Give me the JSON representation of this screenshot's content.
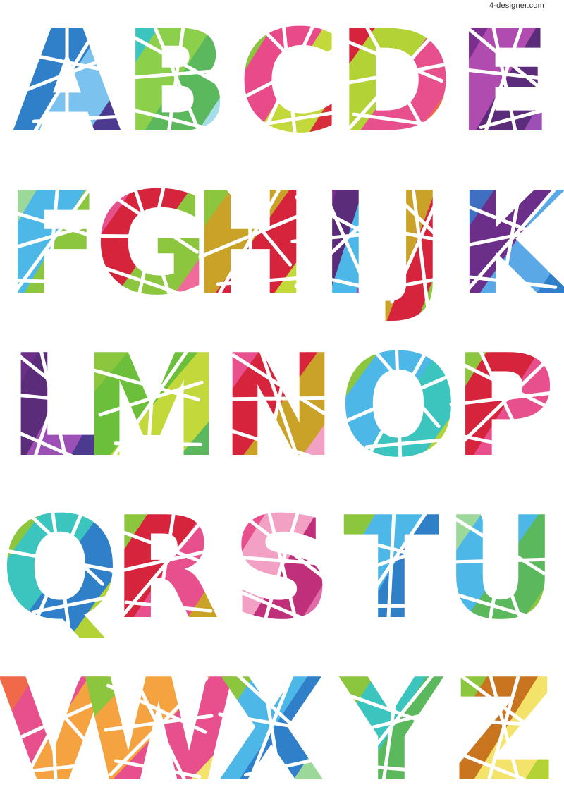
{
  "watermark": "4-designer.com",
  "letters": [
    {
      "char": "A",
      "colors": [
        "#5aa9e6",
        "#2f7fc9",
        "#7bc2ef",
        "#4b3a8f"
      ]
    },
    {
      "char": "B",
      "colors": [
        "#3cc4bf",
        "#8ccf4a",
        "#5cb85c",
        "#a5dde8"
      ]
    },
    {
      "char": "C",
      "colors": [
        "#8cc63f",
        "#e84a8a",
        "#c3d93b",
        "#d62e3a"
      ]
    },
    {
      "char": "D",
      "colors": [
        "#d6243c",
        "#b2d235",
        "#e8508d",
        "#f06a4a"
      ]
    },
    {
      "char": "E",
      "colors": [
        "#7a2f8f",
        "#b04bb0",
        "#5b2c7a",
        "#9c4fb5"
      ]
    },
    {
      "char": "F",
      "colors": [
        "#9bd89a",
        "#4db8e8",
        "#8cc63f",
        "#c6e6a0"
      ]
    },
    {
      "char": "G",
      "colors": [
        "#e8508d",
        "#d6243c",
        "#8cc63f",
        "#f06a9a"
      ]
    },
    {
      "char": "H",
      "colors": [
        "#8cc63f",
        "#c9a227",
        "#d6243c",
        "#c3d93b"
      ]
    },
    {
      "char": "I",
      "colors": [
        "#7a2f8f",
        "#5b2c7a",
        "#4db8e8",
        "#a24fb5"
      ]
    },
    {
      "char": "J",
      "colors": [
        "#b2d235",
        "#c9a227",
        "#d6243c",
        "#8cc63f"
      ]
    },
    {
      "char": "K",
      "colors": [
        "#3f6fc0",
        "#6b2f8a",
        "#5aa9e6",
        "#2f7fc9"
      ]
    },
    {
      "char": "L",
      "colors": [
        "#6b2f8a",
        "#5b2c7a",
        "#9c4fb5",
        "#4b3a8f"
      ]
    },
    {
      "char": "M",
      "colors": [
        "#8cc63f",
        "#6bbf3a",
        "#c3d93b",
        "#5cb85c"
      ]
    },
    {
      "char": "N",
      "colors": [
        "#e8508d",
        "#d6243c",
        "#c9a227",
        "#f2a0c4"
      ]
    },
    {
      "char": "O",
      "colors": [
        "#8cc63f",
        "#4db8e8",
        "#3cc4bf",
        "#b2d235"
      ]
    },
    {
      "char": "P",
      "colors": [
        "#8cc63f",
        "#d6243c",
        "#e8508d",
        "#c9a227"
      ]
    },
    {
      "char": "Q",
      "colors": [
        "#8cc63f",
        "#3cc4bf",
        "#2f7fc9",
        "#b2d235"
      ]
    },
    {
      "char": "R",
      "colors": [
        "#8cc63f",
        "#d6243c",
        "#e8508d",
        "#c9a227"
      ]
    },
    {
      "char": "S",
      "colors": [
        "#e8508d",
        "#f2a0c4",
        "#c0307a",
        "#e06aa8"
      ]
    },
    {
      "char": "T",
      "colors": [
        "#8cc63f",
        "#4db8e8",
        "#2f7fc9",
        "#9bd89a"
      ]
    },
    {
      "char": "U",
      "colors": [
        "#9bd89a",
        "#4db8e8",
        "#5cb85c",
        "#8cc63f"
      ]
    },
    {
      "char": "V",
      "colors": [
        "#f06a4a",
        "#e8508d",
        "#f4a340",
        "#b2d235"
      ]
    },
    {
      "char": "W",
      "colors": [
        "#8cc63f",
        "#f4a340",
        "#e8508d",
        "#f3e36b"
      ]
    },
    {
      "char": "X",
      "colors": [
        "#8cc63f",
        "#4db8e8",
        "#2f7fc9",
        "#9bd89a"
      ]
    },
    {
      "char": "Y",
      "colors": [
        "#8cc63f",
        "#3cc4bf",
        "#5cb85c",
        "#b2d235"
      ]
    },
    {
      "char": "Z",
      "colors": [
        "#8cc63f",
        "#c9741f",
        "#f3e36b",
        "#b2d235"
      ]
    }
  ]
}
